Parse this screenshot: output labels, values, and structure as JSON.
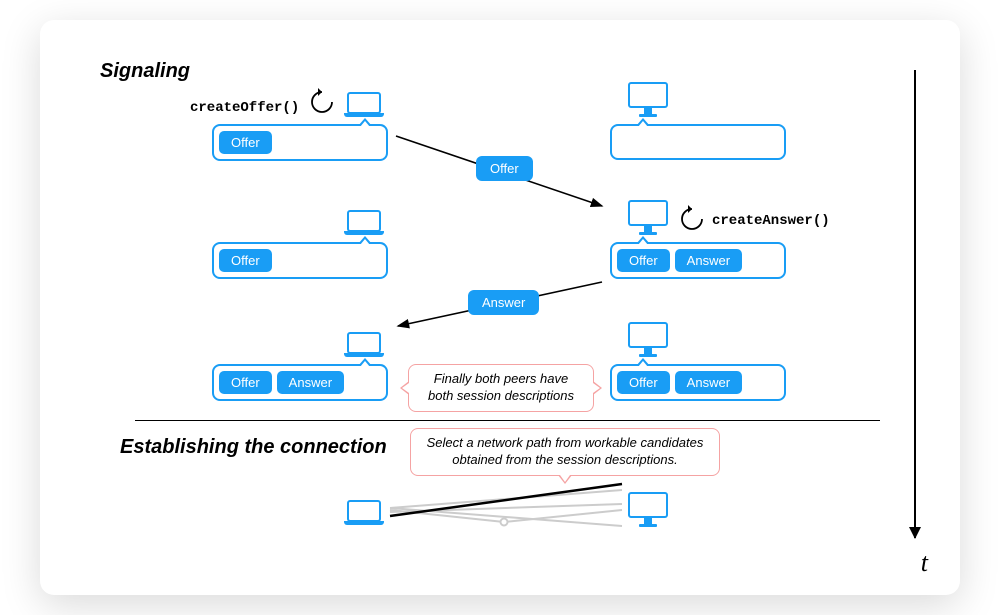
{
  "headings": {
    "signaling": "Signaling",
    "establishing": "Establishing the connection"
  },
  "code": {
    "createOffer": "createOffer()",
    "createAnswer": "createAnswer()"
  },
  "chips": {
    "offer": "Offer",
    "answer": "Answer"
  },
  "transit": {
    "offer": "Offer",
    "answer": "Answer"
  },
  "callouts": {
    "bothPeers": "Finally both peers have both session descriptions",
    "selectPath": "Select a network path from workable candidates obtained from the session descriptions."
  },
  "timeAxis": "t"
}
